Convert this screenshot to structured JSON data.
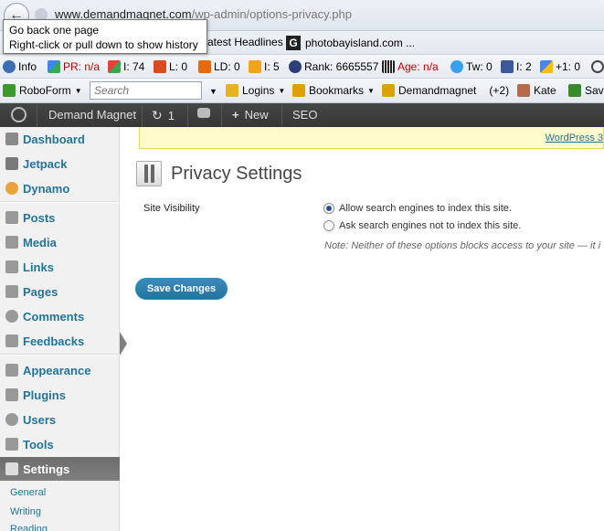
{
  "browser": {
    "url_host": "www.demandmagnet.com",
    "url_path": "/wp-admin/options-privacy.php",
    "tooltip_line1": "Go back one page",
    "tooltip_line2": "Right-click or pull down to show history",
    "bookmarks": [
      "atest Headlines",
      "photobayisland.com ..."
    ]
  },
  "seo_toolbar": {
    "info": "Info",
    "pr": "PR: n/a",
    "i1": "I: 74",
    "l": "L: 0",
    "ld": "LD: 0",
    "i2": "I: 5",
    "rank": "Rank: 6665557",
    "age": "Age: n/a",
    "tw": "Tw: 0",
    "i3": "I: 2",
    "plus1": "+1: 0"
  },
  "roboform_bar": {
    "roboform": "RoboForm",
    "search_placeholder": "Search",
    "logins": "Logins",
    "bookmarks": "Bookmarks",
    "demandmagnet": "Demandmagnet",
    "plus2": "(+2)",
    "kate": "Kate",
    "save": "Sav"
  },
  "admin_bar": {
    "site_name": "Demand Magnet",
    "updates_count": "1",
    "new_label": "New",
    "seo_label": "SEO"
  },
  "sidebar": {
    "items": [
      {
        "label": "Dashboard"
      },
      {
        "label": "Jetpack"
      },
      {
        "label": "Dynamo"
      },
      {
        "label": "Posts"
      },
      {
        "label": "Media"
      },
      {
        "label": "Links"
      },
      {
        "label": "Pages"
      },
      {
        "label": "Comments"
      },
      {
        "label": "Feedbacks"
      },
      {
        "label": "Appearance"
      },
      {
        "label": "Plugins"
      },
      {
        "label": "Users"
      },
      {
        "label": "Tools"
      },
      {
        "label": "Settings"
      }
    ],
    "settings_submenu": [
      "General",
      "Writing",
      "Reading"
    ]
  },
  "main": {
    "notice_link": "WordPress 3",
    "page_title": "Privacy Settings",
    "row_label": "Site Visibility",
    "option_allow": "Allow search engines to index this site.",
    "option_ask": "Ask search engines not to index this site.",
    "note": "Note: Neither of these options blocks access to your site — it i",
    "save_button": "Save Changes"
  },
  "colors": {
    "admin_bar": "#464646",
    "link_blue": "#21759b",
    "notice_bg": "#fffbcc",
    "button_blue": "#21759b"
  }
}
